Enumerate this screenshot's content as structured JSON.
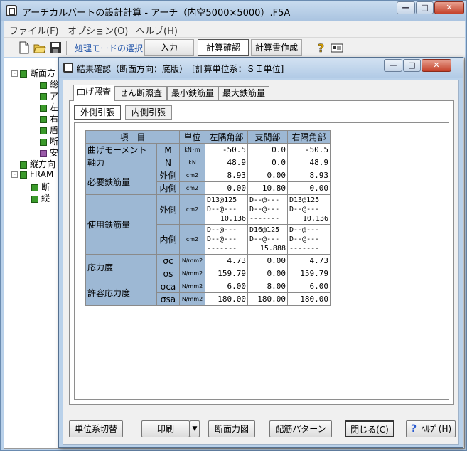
{
  "app": {
    "title": "アーチカルバートの設計計算 - アーチ（内空5000×5000）.F5A",
    "window_controls": [
      "minimize",
      "maximize",
      "close"
    ]
  },
  "menu": [
    "ファイル(F)",
    "オプション(O)",
    "ヘルプ(H)"
  ],
  "toolbar": {
    "mode_label": "処理モードの選択",
    "buttons": [
      "入力",
      "計算確認",
      "計算書作成"
    ],
    "active_button": "計算確認"
  },
  "tree": [
    {
      "label": "断面方",
      "level": 0,
      "color": "green",
      "expander": "-"
    },
    {
      "label": "総",
      "level": 1,
      "color": "green"
    },
    {
      "label": "ア",
      "level": 1,
      "color": "green"
    },
    {
      "label": "左",
      "level": 1,
      "color": "green"
    },
    {
      "label": "右",
      "level": 1,
      "color": "green"
    },
    {
      "label": "盾",
      "level": 1,
      "color": "green"
    },
    {
      "label": "断",
      "level": 1,
      "color": "green"
    },
    {
      "label": "安",
      "level": 1,
      "color": "purple"
    },
    {
      "label": "縦方向",
      "level": 0,
      "color": "green"
    },
    {
      "label": "FRAM",
      "level": 0,
      "color": "green",
      "expander": "-"
    },
    {
      "label": "断",
      "level": 1,
      "color": "green"
    },
    {
      "label": "縦",
      "level": 1,
      "color": "green"
    }
  ],
  "dialog": {
    "title": "結果確認（断面方向：底版）　[計算単位系：ＳＩ単位]",
    "tabs": [
      "曲げ照査",
      "せん断照査",
      "最小鉄筋量",
      "最大鉄筋量"
    ],
    "active_tab": "曲げ照査",
    "subtabs": [
      "外側引張",
      "内側引張"
    ],
    "active_subtab": "外側引張",
    "table": {
      "headers": [
        "項　目",
        "単位",
        "左隅角部",
        "支間部",
        "右隅角部"
      ],
      "rows": {
        "moment": {
          "label": "曲げモーメント",
          "sym": "M",
          "unit": "kN･m",
          "values": [
            "-50.5",
            "0.0",
            "-50.5"
          ]
        },
        "axial": {
          "label": "軸力",
          "sym": "N",
          "unit": "kN",
          "values": [
            "48.9",
            "0.0",
            "48.9"
          ]
        },
        "req_label": "必要鉄筋量",
        "req_outer": {
          "side": "外側",
          "unit": "cm2",
          "values": [
            "8.93",
            "0.00",
            "8.93"
          ]
        },
        "req_inner": {
          "side": "内側",
          "unit": "cm2",
          "values": [
            "0.00",
            "10.80",
            "0.00"
          ]
        },
        "use_label": "使用鉄筋量",
        "use_outer": {
          "side": "外側",
          "unit": "cm2",
          "values": [
            [
              "D13@125",
              "D--@---",
              "10.136"
            ],
            [
              "D--@---",
              "D--@---",
              "-------"
            ],
            [
              "D13@125",
              "D--@---",
              "10.136"
            ]
          ]
        },
        "use_inner": {
          "side": "内側",
          "unit": "cm2",
          "values": [
            [
              "D--@---",
              "D--@---",
              "-------"
            ],
            [
              "D16@125",
              "D--@---",
              "15.888"
            ],
            [
              "D--@---",
              "D--@---",
              "-------"
            ]
          ]
        },
        "stress_label": "応力度",
        "sigma_c": {
          "sym": "σc",
          "unit": "N/mm2",
          "values": [
            "4.73",
            "0.00",
            "4.73"
          ]
        },
        "sigma_s": {
          "sym": "σs",
          "unit": "N/mm2",
          "values": [
            "159.79",
            "0.00",
            "159.79"
          ]
        },
        "allow_label": "許容応力度",
        "sigma_ca": {
          "sym": "σca",
          "unit": "N/mm2",
          "values": [
            "6.00",
            "8.00",
            "6.00"
          ]
        },
        "sigma_sa": {
          "sym": "σsa",
          "unit": "N/mm2",
          "values": [
            "180.00",
            "180.00",
            "180.00"
          ]
        }
      }
    },
    "buttons": {
      "unit_switch": "単位系切替",
      "print": "印刷",
      "section_force": "断面力図",
      "rebar_pattern": "配筋パターン",
      "close": "閉じる(C)",
      "help": "ﾍﾙﾌﾟ(H)"
    }
  }
}
